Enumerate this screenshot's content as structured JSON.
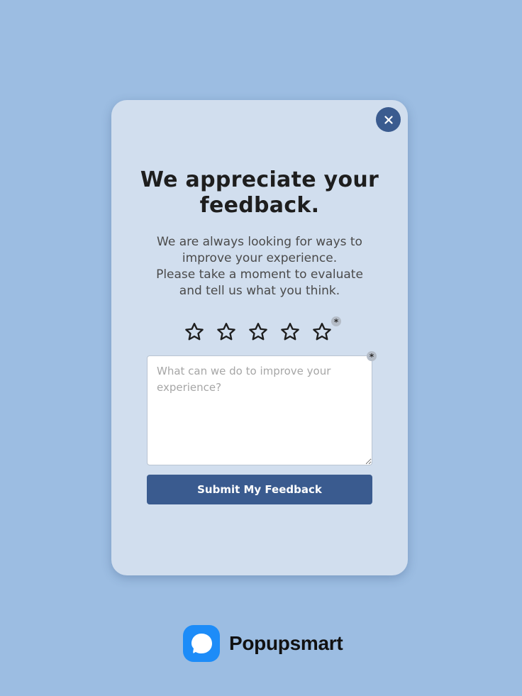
{
  "popup": {
    "title_line1": "We appreciate your",
    "title_line2": "feedback.",
    "subtitle_lines": [
      "We are always looking for ways to",
      "improve your experience.",
      "Please take a moment to evaluate",
      "and tell us what you think."
    ],
    "rating": {
      "max": 5,
      "value": 0
    },
    "required_marker": "*",
    "feedback_placeholder": "What can we do to improve your experience?",
    "feedback_value": "",
    "submit_label": "Submit My Feedback"
  },
  "brand": {
    "name": "Popupsmart"
  },
  "icons": {
    "close": "close-icon",
    "star": "star-outline-icon",
    "logo": "popupsmart-logo-icon"
  },
  "colors": {
    "background": "#9cbde2",
    "panel": "#d1deee",
    "accent": "#3a5b8f",
    "logo": "#1d8cf8"
  }
}
